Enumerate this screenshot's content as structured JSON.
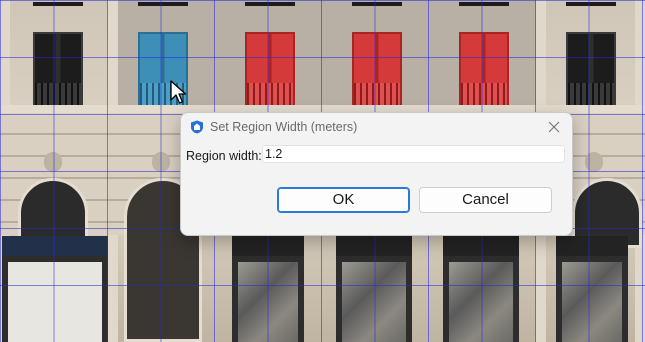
{
  "dialog": {
    "title": "Set Region Width (meters)",
    "app_icon": "blue-shield-logo-icon",
    "close_icon": "close-icon",
    "field_label": "Region width:",
    "field_value": "1.2",
    "ok_label": "OK",
    "cancel_label": "Cancel"
  },
  "viewport": {
    "scene": "building facade texture with blue region grid overlay",
    "highlight_colors": {
      "selected_blue": "#3d8fb8",
      "selected_red": "#d43a3a",
      "grid_lines": "#2828dc"
    }
  },
  "colors": {
    "dialog_bg": "#f3f3f3",
    "accent": "#2a7ad8"
  }
}
